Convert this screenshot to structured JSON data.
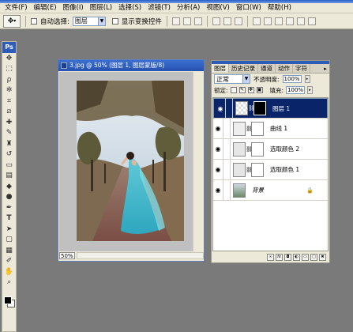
{
  "menu": [
    "文件(F)",
    "编辑(E)",
    "图像(I)",
    "图层(L)",
    "选择(S)",
    "滤镜(T)",
    "分析(A)",
    "视图(V)",
    "窗口(W)",
    "帮助(H)"
  ],
  "options": {
    "auto_select_label": "自动选择:",
    "auto_select_value": "图层",
    "show_transform_label": "显示变换控件"
  },
  "toolbox": {
    "logo": "Ps",
    "tools": [
      "move-tool",
      "marquee-tool",
      "lasso-tool",
      "magic-wand-tool",
      "crop-tool",
      "slice-tool",
      "healing-brush-tool",
      "brush-tool",
      "clone-stamp-tool",
      "history-brush-tool",
      "eraser-tool",
      "gradient-tool",
      "blur-tool",
      "dodge-tool",
      "pen-tool",
      "type-tool",
      "path-selection-tool",
      "shape-tool",
      "notes-tool",
      "eyedropper-tool",
      "hand-tool",
      "zoom-tool"
    ],
    "foreground_color": "#000000",
    "background_color": "#ffffff"
  },
  "document": {
    "title": "3.jpg @ 50% (图层 1, 图层蒙版/8)",
    "zoom": "50%"
  },
  "layers_panel": {
    "tabs": [
      "图层",
      "历史记录",
      "通道",
      "动作",
      "字符"
    ],
    "blend_mode": "正常",
    "opacity_label": "不透明度:",
    "opacity_value": "100%",
    "lock_label": "锁定:",
    "fill_label": "填充:",
    "fill_value": "100%",
    "layers": [
      {
        "name": "图层 1",
        "selected": true
      },
      {
        "name": "曲线 1",
        "selected": false
      },
      {
        "name": "选取颜色 2",
        "selected": false
      },
      {
        "name": "选取颜色 1",
        "selected": false
      },
      {
        "name": "背景",
        "selected": false
      }
    ]
  },
  "colors": {
    "accent": "#0a246a",
    "title_blue": "#2452b0",
    "panel_bg": "#ece9d8",
    "workspace": "#7a7a7a"
  }
}
